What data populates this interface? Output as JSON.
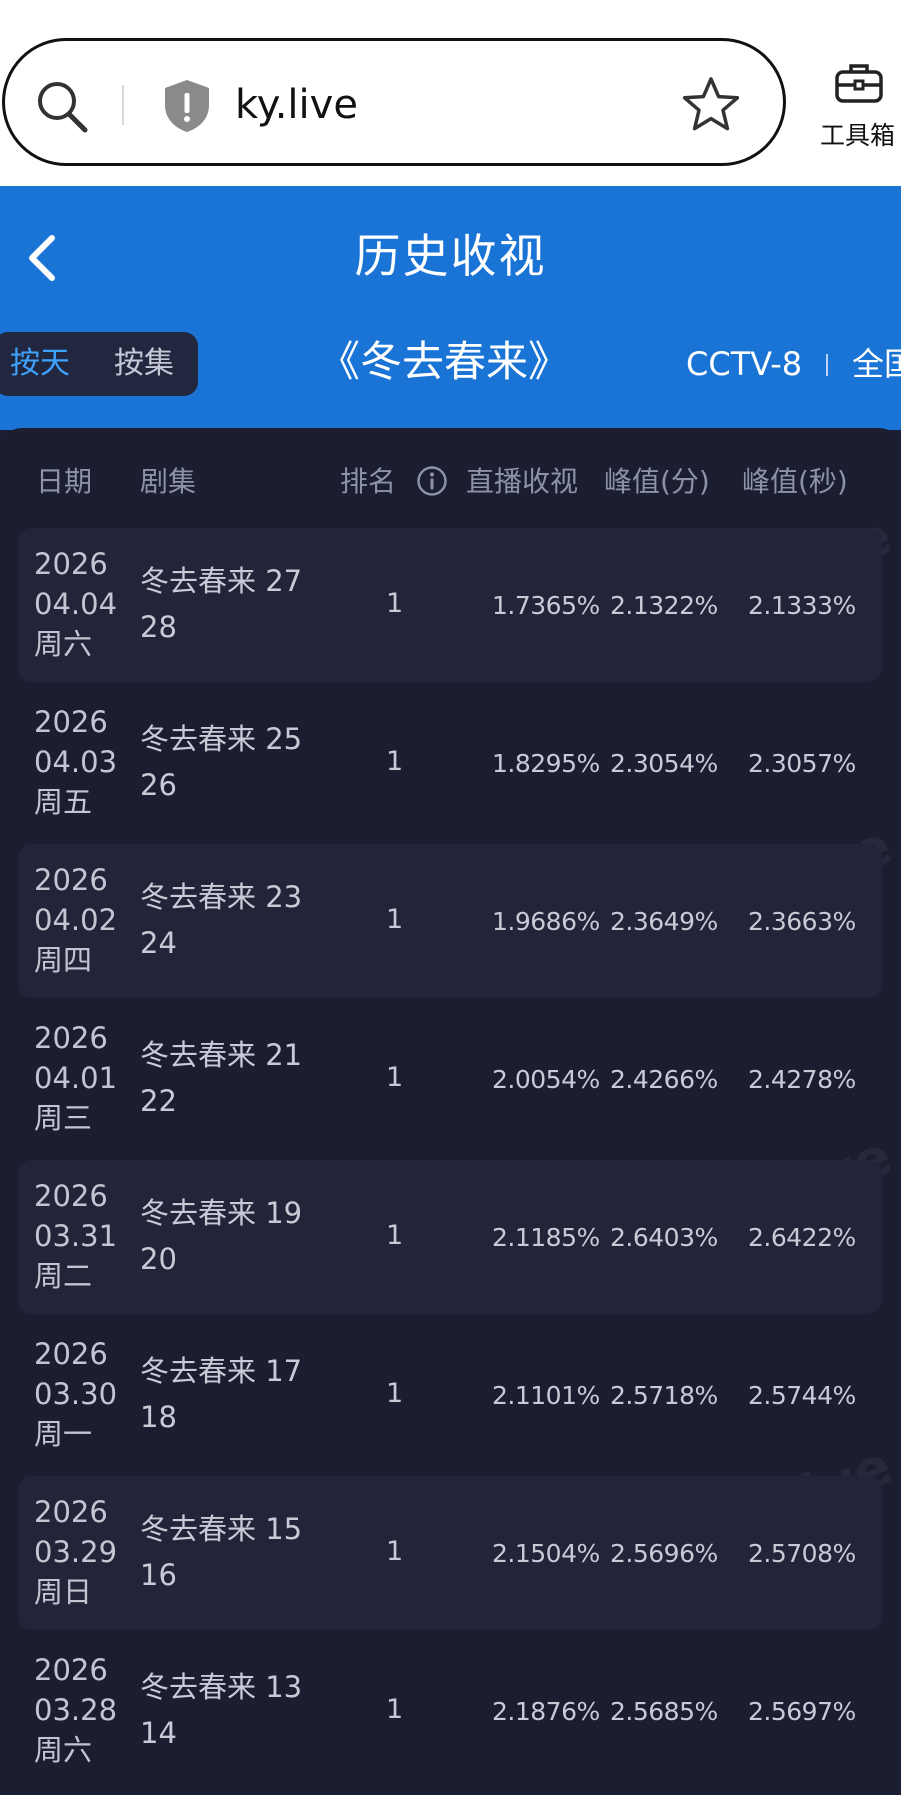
{
  "browser": {
    "url": "ky.live",
    "toolbox_label": "工具箱"
  },
  "header": {
    "title": "历史收视",
    "toggle": {
      "by_day": "按天",
      "by_episode": "按集",
      "selected": "by_day"
    },
    "show_title": "《冬去春来》",
    "channel": "CCTV-8",
    "region": "全国"
  },
  "table": {
    "columns": {
      "date": "日期",
      "episode": "剧集",
      "rank": "排名",
      "live_rating": "直播收视",
      "peak_minute": "峰值(分)",
      "peak_second": "峰值(秒)"
    },
    "rows": [
      {
        "year": "2026",
        "md": "04.04",
        "weekday": "周六",
        "ep_line1": "冬去春来 27",
        "ep_line2": "28",
        "rank": "1",
        "live": "1.7365%",
        "peak_min": "2.1322%",
        "peak_sec": "2.1333%"
      },
      {
        "year": "2026",
        "md": "04.03",
        "weekday": "周五",
        "ep_line1": "冬去春来 25",
        "ep_line2": "26",
        "rank": "1",
        "live": "1.8295%",
        "peak_min": "2.3054%",
        "peak_sec": "2.3057%"
      },
      {
        "year": "2026",
        "md": "04.02",
        "weekday": "周四",
        "ep_line1": "冬去春来 23",
        "ep_line2": "24",
        "rank": "1",
        "live": "1.9686%",
        "peak_min": "2.3649%",
        "peak_sec": "2.3663%"
      },
      {
        "year": "2026",
        "md": "04.01",
        "weekday": "周三",
        "ep_line1": "冬去春来 21",
        "ep_line2": "22",
        "rank": "1",
        "live": "2.0054%",
        "peak_min": "2.4266%",
        "peak_sec": "2.4278%"
      },
      {
        "year": "2026",
        "md": "03.31",
        "weekday": "周二",
        "ep_line1": "冬去春来 19",
        "ep_line2": "20",
        "rank": "1",
        "live": "2.1185%",
        "peak_min": "2.6403%",
        "peak_sec": "2.6422%"
      },
      {
        "year": "2026",
        "md": "03.30",
        "weekday": "周一",
        "ep_line1": "冬去春来 17",
        "ep_line2": "18",
        "rank": "1",
        "live": "2.1101%",
        "peak_min": "2.5718%",
        "peak_sec": "2.5744%"
      },
      {
        "year": "2026",
        "md": "03.29",
        "weekday": "周日",
        "ep_line1": "冬去春来 15",
        "ep_line2": "16",
        "rank": "1",
        "live": "2.1504%",
        "peak_min": "2.5696%",
        "peak_sec": "2.5708%"
      },
      {
        "year": "2026",
        "md": "03.28",
        "weekday": "周六",
        "ep_line1": "冬去春来 13",
        "ep_line2": "14",
        "rank": "1",
        "live": "2.1876%",
        "peak_min": "2.5685%",
        "peak_sec": "2.5697%"
      }
    ]
  },
  "watermark": "ky.live",
  "colors": {
    "header_blue": "#1a74d6",
    "panel_bg": "#1b1e31",
    "row_stripe": "#222539",
    "toggle_active": "#3ea2ff"
  },
  "icons": [
    "search-icon",
    "shield-icon",
    "star-icon",
    "toolbox-icon",
    "back-icon",
    "info-icon"
  ]
}
